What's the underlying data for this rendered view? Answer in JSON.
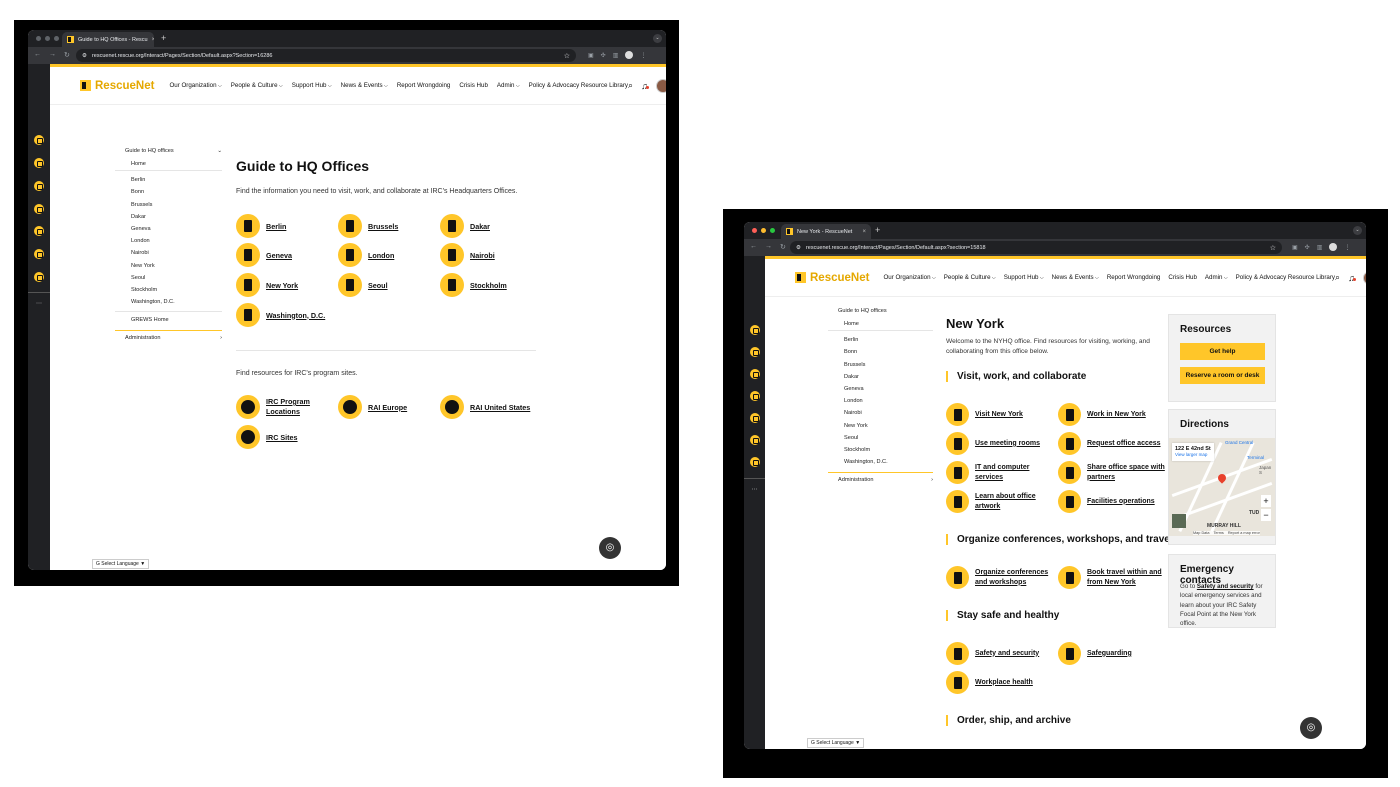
{
  "colors": {
    "brand_yellow": "#ffc629",
    "chrome_dark": "#202124",
    "chrome_tab": "#35363a",
    "text": "#111111",
    "notification_red": "#e8412c"
  },
  "header": {
    "logo": "RescueNet",
    "nav": [
      "Our Organization",
      "People & Culture",
      "Support Hub",
      "News & Events",
      "Report Wrongdoing",
      "Crisis Hub",
      "Admin",
      "Policy & Advocacy Resource Library"
    ],
    "icons": [
      "search-icon",
      "bell-icon",
      "avatar"
    ]
  },
  "sidenav": {
    "title": "Guide to HQ offices",
    "items": [
      "Home",
      "Berlin",
      "Bonn",
      "Brussels",
      "Dakar",
      "Geneva",
      "London",
      "Nairobi",
      "New York",
      "Seoul",
      "Stockholm",
      "Washington, D.C."
    ],
    "extra": "GREWS Home",
    "admin": "Administration"
  },
  "language": "Select Language",
  "left_window": {
    "tab_title": "Guide to HQ Offices - Rescu",
    "url": "rescuenet.rescue.org/Interact/Pages/Section/Default.aspx?Section=16286",
    "page_title": "Guide to HQ Offices",
    "intro": "Find the information you need to visit, work, and collaborate at IRC's Headquarters Offices.",
    "offices": [
      "Berlin",
      "Brussels",
      "Dakar",
      "Geneva",
      "London",
      "Nairobi",
      "New York",
      "Seoul",
      "Stockholm",
      "Washington, D.C."
    ],
    "resources_intro": "Find resources for IRC's program sites.",
    "resources": [
      "IRC Program Locations",
      "RAI Europe",
      "RAI United States",
      "IRC Sites"
    ]
  },
  "right_window": {
    "tab_title": "New York - RescueNet",
    "url": "rescuenet.rescue.org/Interact/Pages/Section/Default.aspx?section=15818",
    "page_title": "New York",
    "intro": "Welcome to the NYHQ office. Find resources for visiting, working, and collaborating from this office below.",
    "sections": [
      {
        "title": "Visit, work, and collaborate",
        "links": [
          "Visit New York",
          "Work in New York",
          "Use meeting rooms",
          "Request office access",
          "IT and computer services",
          "Share office space with partners",
          "Learn about office artwork",
          "Facilities operations"
        ]
      },
      {
        "title": "Organize conferences, workshops, and travel",
        "links": [
          "Organize conferences and workshops",
          "Book travel within and from New York"
        ]
      },
      {
        "title": "Stay safe and healthy",
        "links": [
          "Safety and security",
          "Safeguarding",
          "Workplace health"
        ]
      },
      {
        "title": "Order, ship, and archive",
        "links": []
      }
    ],
    "resources_card": {
      "title": "Resources",
      "buttons": [
        "Get help",
        "Reserve a room or desk"
      ]
    },
    "directions_card": {
      "title": "Directions",
      "address": "122 E 42nd St",
      "map_link": "View larger map",
      "map_labels": [
        "Grand Central",
        "Terminal",
        "Japan S",
        "MURRAY HILL",
        "TUD"
      ],
      "footer": [
        "Map Data",
        "Terms",
        "Report a map error"
      ]
    },
    "emergency_card": {
      "title": "Emergency contacts",
      "pre": "Go to",
      "link": "Safety and security",
      "post": "for local emergency services and learn about your IRC Safety Focal Point at the New York office."
    }
  }
}
